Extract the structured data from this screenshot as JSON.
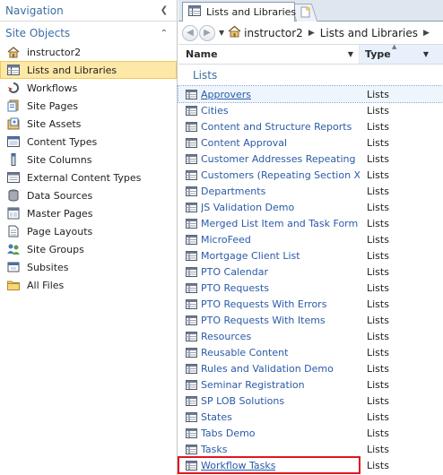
{
  "nav": {
    "title": "Navigation",
    "group_title": "Site Objects",
    "items": [
      {
        "label": "instructor2",
        "icon": "home-icon"
      },
      {
        "label": "Lists and Libraries",
        "icon": "list-icon",
        "selected": true
      },
      {
        "label": "Workflows",
        "icon": "workflow-icon"
      },
      {
        "label": "Site Pages",
        "icon": "site-pages-icon"
      },
      {
        "label": "Site Assets",
        "icon": "site-assets-icon"
      },
      {
        "label": "Content Types",
        "icon": "content-types-icon"
      },
      {
        "label": "Site Columns",
        "icon": "site-columns-icon"
      },
      {
        "label": "External Content Types",
        "icon": "external-content-types-icon"
      },
      {
        "label": "Data Sources",
        "icon": "data-sources-icon"
      },
      {
        "label": "Master Pages",
        "icon": "master-pages-icon"
      },
      {
        "label": "Page Layouts",
        "icon": "page-layouts-icon"
      },
      {
        "label": "Site Groups",
        "icon": "site-groups-icon"
      },
      {
        "label": "Subsites",
        "icon": "subsites-icon"
      },
      {
        "label": "All Files",
        "icon": "all-files-icon"
      }
    ]
  },
  "tab": {
    "label": "Lists and Libraries"
  },
  "breadcrumb": {
    "site": "instructor2",
    "page": "Lists and Libraries"
  },
  "columns": {
    "name": "Name",
    "type": "Type"
  },
  "group_label": "Lists",
  "rows": [
    {
      "name": "Approvers",
      "type": "Lists"
    },
    {
      "name": "Cities",
      "type": "Lists"
    },
    {
      "name": "Content and Structure Reports",
      "type": "Lists"
    },
    {
      "name": "Content Approval",
      "type": "Lists"
    },
    {
      "name": "Customer Addresses Repeating ...",
      "type": "Lists"
    },
    {
      "name": "Customers (Repeating Section X...",
      "type": "Lists"
    },
    {
      "name": "Departments",
      "type": "Lists"
    },
    {
      "name": "JS Validation Demo",
      "type": "Lists"
    },
    {
      "name": "Merged List Item and Task Form ...",
      "type": "Lists"
    },
    {
      "name": "MicroFeed",
      "type": "Lists"
    },
    {
      "name": "Mortgage Client List",
      "type": "Lists"
    },
    {
      "name": "PTO Calendar",
      "type": "Lists"
    },
    {
      "name": "PTO Requests",
      "type": "Lists"
    },
    {
      "name": "PTO Requests With Errors",
      "type": "Lists"
    },
    {
      "name": "PTO Requests With Items",
      "type": "Lists"
    },
    {
      "name": "Resources",
      "type": "Lists"
    },
    {
      "name": "Reusable Content",
      "type": "Lists"
    },
    {
      "name": "Rules and Validation Demo",
      "type": "Lists"
    },
    {
      "name": "Seminar Registration",
      "type": "Lists"
    },
    {
      "name": "SP LOB Solutions",
      "type": "Lists"
    },
    {
      "name": "States",
      "type": "Lists"
    },
    {
      "name": "Tabs Demo",
      "type": "Lists"
    },
    {
      "name": "Tasks",
      "type": "Lists"
    },
    {
      "name": "Workflow Tasks",
      "type": "Lists"
    }
  ],
  "colors": {
    "accent": "#3a6ea5",
    "link": "#2a5aa8",
    "selected_bg": "#fde8a8",
    "highlight_box": "#e0161e"
  }
}
